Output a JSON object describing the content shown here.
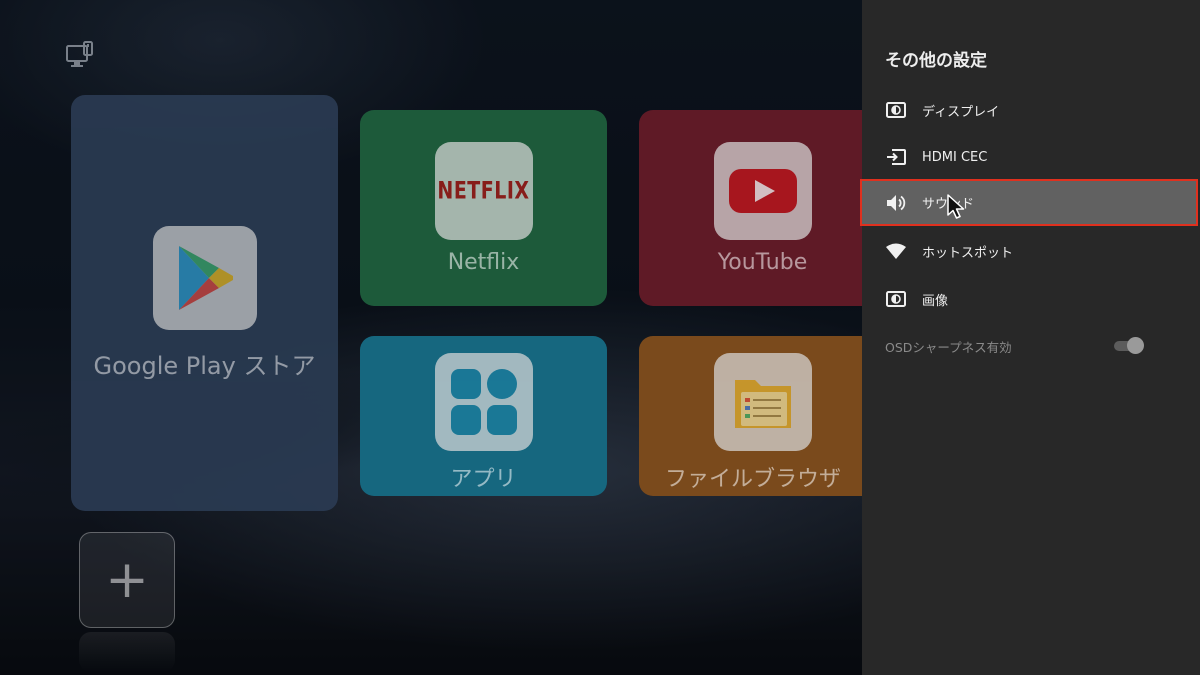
{
  "launcher": {
    "tiles": {
      "google_play": {
        "label": "Google Play ストア",
        "icon": "google-play-icon",
        "color": "#2a3b52"
      },
      "netflix": {
        "label": "Netflix",
        "logo_text": "NETFLIX",
        "icon": "netflix-icon",
        "color": "#1d5a3a"
      },
      "youtube": {
        "label": "YouTube",
        "icon": "youtube-icon",
        "color": "#5f1a26"
      },
      "apps": {
        "label": "アプリ",
        "icon": "apps-grid-icon",
        "color": "#16677f"
      },
      "file_browser": {
        "label": "ファイルブラウザ",
        "icon": "folder-icon",
        "color": "#7a4a1c"
      }
    },
    "add_tile": {
      "symbol": "+",
      "icon": "plus-icon"
    },
    "top_icon": "monitor-icon"
  },
  "settings_panel": {
    "title": "その他の設定",
    "background": "#282828",
    "items": [
      {
        "label": "ディスプレイ",
        "icon": "display-icon"
      },
      {
        "label": "HDMI CEC",
        "icon": "hdmi-input-icon"
      },
      {
        "label": "サウンド",
        "icon": "speaker-icon",
        "selected": true
      },
      {
        "label": "ホットスポット",
        "icon": "wifi-icon"
      },
      {
        "label": "画像",
        "icon": "picture-icon"
      }
    ],
    "osd_toggle": {
      "label": "OSDシャープネス有効",
      "state": "on",
      "enabled": false
    },
    "selection_color": "#e0301e"
  }
}
